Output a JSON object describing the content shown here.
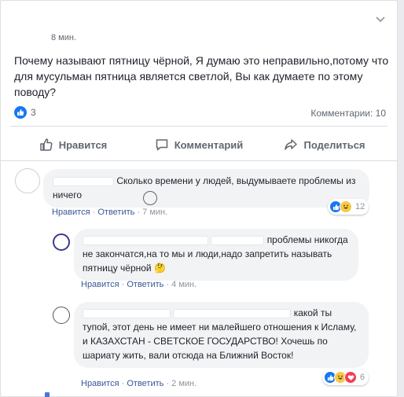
{
  "post": {
    "time": "8 мин.",
    "text": "Почему называют пятницу чёрной, Я думаю это неправильно,потому что для мусульман пятница является светлой, Вы как думаете по этому поводу?",
    "likes": "3",
    "comments_count": "Комментарии: 10"
  },
  "actions": {
    "like": "Нравится",
    "comment": "Комментарий",
    "share": "Поделиться"
  },
  "comments": [
    {
      "text_tail": "Сколько времени у людей, выдумываете проблемы из ничего",
      "like_link": "Нравится",
      "reply_link": "Ответить",
      "time": "7 мин.",
      "reactions_count": "12"
    },
    {
      "text_tail": "проблемы никогда не закончатся,на то мы и люди,надо запретить называть пятницу чёрной 🤔",
      "like_link": "Нравится",
      "reply_link": "Ответить",
      "time": "4 мин."
    },
    {
      "text_tail": "какой ты тупой, этот день не имеет ни малейшего отношения к Исламу, и КАЗАХСТАН - СВЕТСКОЕ ГОСУДАРСТВО! Хочешь по шариату жить, вали отсюда на Ближний Восток!",
      "like_link": "Нравится",
      "reply_link": "Ответить",
      "time": "2 мин.",
      "reactions_count": "6"
    }
  ],
  "separator": "·",
  "icons": {
    "menu": "chevron-down-icon",
    "like": "thumbs-up-icon",
    "comment": "speech-bubble-icon",
    "share": "share-arrow-icon"
  },
  "colors": {
    "link": "#385898",
    "like_blue": "#1877f2",
    "haha_yellow": "#f7c948",
    "love_red": "#f33e58"
  }
}
